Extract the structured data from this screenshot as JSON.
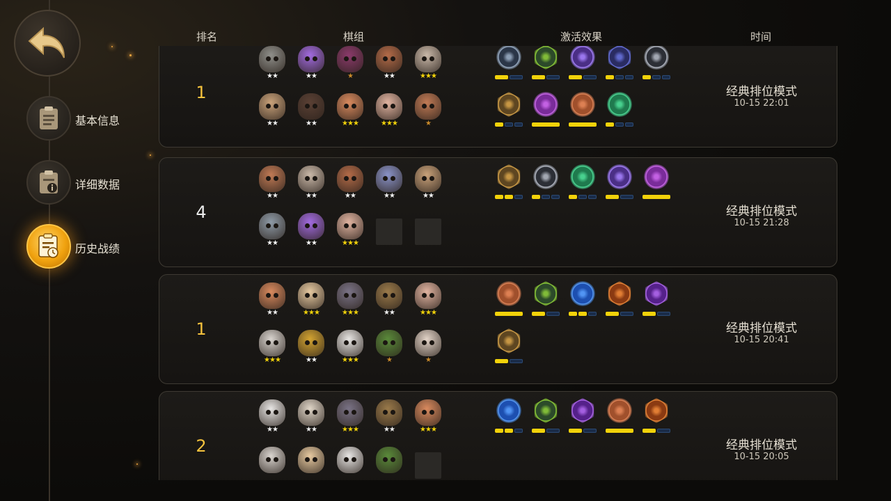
{
  "headers": {
    "rank": "排名",
    "team": "棋组",
    "effects": "激活效果",
    "time": "时间"
  },
  "nav": [
    {
      "label": "基本信息",
      "icon": "clipboard-icon",
      "active": false
    },
    {
      "label": "详细数据",
      "icon": "info-clipboard-icon",
      "active": false
    },
    {
      "label": "历史战绩",
      "icon": "history-clipboard-icon",
      "active": true
    }
  ],
  "matches": [
    {
      "rank": "1",
      "rank_color": "gold",
      "mode": "经典排位模式",
      "time": "10-15 22:01",
      "units": [
        {
          "name": "hooded-knight",
          "stars": 2,
          "color": "#8f8f8a"
        },
        {
          "name": "purple-witch",
          "stars": 2,
          "color": "#a26be0"
        },
        {
          "name": "masked-demon",
          "stars": 1,
          "color": "#8a3a6a"
        },
        {
          "name": "bearded-pirate",
          "stars": 2,
          "color": "#b36b48"
        },
        {
          "name": "gray-hair-elder",
          "stars": 3,
          "color": "#c9b8a8"
        },
        {
          "name": "horned-goat",
          "stars": 2,
          "color": "#c9a27a"
        },
        {
          "name": "dark-hair-warrior",
          "stars": 2,
          "color": "#5a4034"
        },
        {
          "name": "goggle-dwarf",
          "stars": 3,
          "color": "#d98a5e"
        },
        {
          "name": "white-beard-dwarf",
          "stars": 3,
          "color": "#e0b3a0"
        },
        {
          "name": "cap-brawler",
          "stars": 1,
          "color": "#c07a55"
        }
      ],
      "traits": [
        {
          "name": "claw-trait",
          "shape": "circle",
          "color": "#2b3648",
          "ring": "#9db0c8",
          "bars": [
            1,
            0
          ]
        },
        {
          "name": "bow-trait",
          "shape": "hex",
          "color": "#2c4a2a",
          "ring": "#8fcf3a",
          "bars": [
            1,
            0
          ]
        },
        {
          "name": "fishbone-trait",
          "shape": "circle",
          "color": "#4b2f86",
          "ring": "#a883ff",
          "bars": [
            1,
            0
          ]
        },
        {
          "name": "demon-trait",
          "shape": "hex",
          "color": "#2a2c62",
          "ring": "#6a74e0",
          "bars": [
            1,
            0,
            0
          ]
        },
        {
          "name": "helm-trait",
          "shape": "circle",
          "color": "#2c2f36",
          "ring": "#b7bcc7",
          "bars": [
            1,
            0,
            0
          ]
        },
        {
          "name": "axe-trait",
          "shape": "hex",
          "color": "#5e4621",
          "ring": "#d8a44a",
          "bars": [
            1,
            0,
            0
          ]
        },
        {
          "name": "skull-trait",
          "shape": "circle",
          "color": "#7a2c9a",
          "ring": "#d06af0",
          "bars": [
            1
          ]
        },
        {
          "name": "beast-trait",
          "shape": "circle",
          "color": "#a0502c",
          "ring": "#e8895a",
          "bars": [
            1
          ]
        },
        {
          "name": "paw-trait",
          "shape": "circle",
          "color": "#1f7a4e",
          "ring": "#4fe09a",
          "bars": [
            1,
            0,
            0
          ]
        }
      ]
    },
    {
      "rank": "4",
      "rank_color": "white",
      "mode": "经典排位模式",
      "time": "10-15 21:28",
      "units": [
        {
          "name": "cap-brawler",
          "stars": 2,
          "color": "#c07a55"
        },
        {
          "name": "gray-hair-elder",
          "stars": 2,
          "color": "#c9b8a8"
        },
        {
          "name": "bearded-pirate",
          "stars": 2,
          "color": "#b36b48"
        },
        {
          "name": "hooded-ghost",
          "stars": 2,
          "color": "#8a93c8"
        },
        {
          "name": "horned-goat",
          "stars": 2,
          "color": "#c9a27a"
        },
        {
          "name": "armored-ogre",
          "stars": 2,
          "color": "#8e9aa6"
        },
        {
          "name": "purple-witch",
          "stars": 2,
          "color": "#a26be0"
        },
        {
          "name": "white-beard-dwarf",
          "stars": 3,
          "color": "#e0b3a0"
        },
        {
          "name": "empty",
          "stars": 0,
          "color": ""
        },
        {
          "name": "empty",
          "stars": 0,
          "color": ""
        }
      ],
      "traits": [
        {
          "name": "axe-trait",
          "shape": "hex",
          "color": "#5e4621",
          "ring": "#d8a44a",
          "bars": [
            1,
            1,
            0
          ]
        },
        {
          "name": "helm-trait",
          "shape": "circle",
          "color": "#2c2f36",
          "ring": "#b7bcc7",
          "bars": [
            1,
            0,
            0
          ]
        },
        {
          "name": "paw-trait",
          "shape": "circle",
          "color": "#1f7a4e",
          "ring": "#4fe09a",
          "bars": [
            1,
            0,
            0
          ]
        },
        {
          "name": "fishbone-trait",
          "shape": "circle",
          "color": "#4b2f86",
          "ring": "#a883ff",
          "bars": [
            1,
            0
          ]
        },
        {
          "name": "skull-trait",
          "shape": "circle",
          "color": "#7a2c9a",
          "ring": "#d06af0",
          "bars": [
            1
          ]
        }
      ]
    },
    {
      "rank": "1",
      "rank_color": "gold",
      "mode": "经典排位模式",
      "time": "10-15 20:41",
      "units": [
        {
          "name": "goggle-dwarf",
          "stars": 2,
          "color": "#d98a5e"
        },
        {
          "name": "feathered-chief",
          "stars": 3,
          "color": "#e6c9a0"
        },
        {
          "name": "steel-knight",
          "stars": 3,
          "color": "#7a7386"
        },
        {
          "name": "helmed-archer",
          "stars": 2,
          "color": "#9a7a4a"
        },
        {
          "name": "white-beard-dwarf",
          "stars": 3,
          "color": "#e0b3a0"
        },
        {
          "name": "scarred-brute",
          "stars": 3,
          "color": "#d9d4cf"
        },
        {
          "name": "gold-mask-monk",
          "stars": 2,
          "color": "#d4a431"
        },
        {
          "name": "white-goat",
          "stars": 3,
          "color": "#e8e6e4"
        },
        {
          "name": "goblin-helm",
          "stars": 1,
          "color": "#5a8a3a"
        },
        {
          "name": "pale-mask",
          "stars": 1,
          "color": "#e2d3c7"
        }
      ],
      "traits": [
        {
          "name": "beast-trait",
          "shape": "circle",
          "color": "#a0502c",
          "ring": "#e8895a",
          "bars": [
            1
          ]
        },
        {
          "name": "bow-trait",
          "shape": "hex",
          "color": "#2c4a2a",
          "ring": "#8fcf3a",
          "bars": [
            1,
            0
          ]
        },
        {
          "name": "feather-trait",
          "shape": "circle",
          "color": "#1d4fb0",
          "ring": "#5aa0ff",
          "bars": [
            1,
            1,
            0
          ]
        },
        {
          "name": "leaf-trait",
          "shape": "hex",
          "color": "#8a3a12",
          "ring": "#f08a3a",
          "bars": [
            1,
            0
          ]
        },
        {
          "name": "spirit-trait",
          "shape": "hex",
          "color": "#55218a",
          "ring": "#b26af0",
          "bars": [
            1,
            0
          ]
        },
        {
          "name": "gear-trait",
          "shape": "hex",
          "color": "#5e4621",
          "ring": "#d8a44a",
          "bars": [
            1,
            0
          ]
        }
      ]
    },
    {
      "rank": "2",
      "rank_color": "gold",
      "mode": "经典排位模式",
      "time": "10-15 20:05",
      "units": [
        {
          "name": "white-goat",
          "stars": 2,
          "color": "#e8e6e4"
        },
        {
          "name": "white-elder",
          "stars": 2,
          "color": "#e0d6c8"
        },
        {
          "name": "steel-knight",
          "stars": 3,
          "color": "#7a7386"
        },
        {
          "name": "helmed-archer",
          "stars": 2,
          "color": "#9a7a4a"
        },
        {
          "name": "goggle-dwarf",
          "stars": 3,
          "color": "#d98a5e"
        },
        {
          "name": "scarred-brute",
          "stars": 0,
          "color": "#d9d4cf"
        },
        {
          "name": "feathered-chief",
          "stars": 0,
          "color": "#e6c9a0"
        },
        {
          "name": "white-goat",
          "stars": 0,
          "color": "#e8e6e4"
        },
        {
          "name": "goblin-helm",
          "stars": 0,
          "color": "#5a8a3a"
        },
        {
          "name": "empty",
          "stars": 0,
          "color": ""
        }
      ],
      "traits": [
        {
          "name": "feather-trait",
          "shape": "circle",
          "color": "#1d4fb0",
          "ring": "#5aa0ff",
          "bars": [
            1,
            1,
            0
          ]
        },
        {
          "name": "bow-trait",
          "shape": "hex",
          "color": "#2c4a2a",
          "ring": "#8fcf3a",
          "bars": [
            1,
            0
          ]
        },
        {
          "name": "spirit-trait",
          "shape": "hex",
          "color": "#55218a",
          "ring": "#b26af0",
          "bars": [
            1,
            0
          ]
        },
        {
          "name": "beast-trait",
          "shape": "circle",
          "color": "#a0502c",
          "ring": "#e8895a",
          "bars": [
            1
          ]
        },
        {
          "name": "leaf-trait",
          "shape": "hex",
          "color": "#8a3a12",
          "ring": "#f08a3a",
          "bars": [
            1,
            0
          ]
        }
      ]
    }
  ],
  "colors": {
    "gold": "#f5c23d",
    "bar_on": "#f2d20a",
    "bar_off": "#1a2c49",
    "star_gold": "#f2d20a",
    "star_bronze": "#c98a2a"
  }
}
